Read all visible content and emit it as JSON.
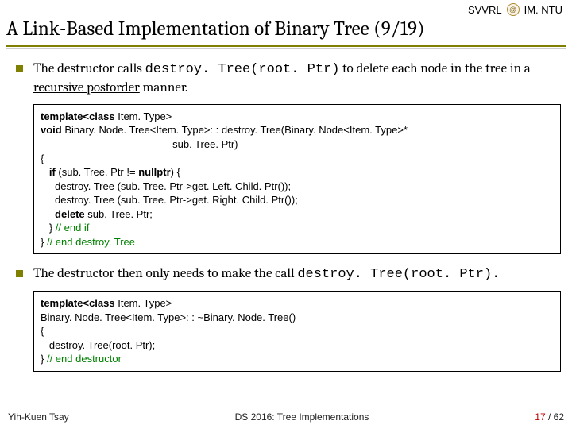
{
  "header": {
    "lab": "SVVRL",
    "at": "@",
    "org": "IM. NTU",
    "title": "A Link-Based Implementation of Binary Tree (9/19)"
  },
  "bullets": {
    "b1_pre": "The destructor calls ",
    "b1_code": "destroy. Tree(root. Ptr)",
    "b1_mid": " to delete each node in the tree in a ",
    "b1_u": "recursive postorder",
    "b1_post": " manner.",
    "b2_pre": "The destructor then only needs to make the call ",
    "b2_code": "destroy. Tree(root. Ptr)."
  },
  "code1": {
    "l1a": "template<",
    "l1b": "class",
    "l1c": " Item. Type>",
    "l2a": "void",
    "l2b": " Binary. Node. Tree<Item. Type>: : destroy. Tree(Binary. Node<Item. Type>*",
    "l3": "                                              sub. Tree. Ptr)",
    "l4": "{",
    "l5a": "   if",
    "l5b": " (sub. Tree. Ptr != ",
    "l5c": "nullptr",
    "l5d": ") {",
    "l6": "     destroy. Tree (sub. Tree. Ptr->get. Left. Child. Ptr());",
    "l7": "     destroy. Tree (sub. Tree. Ptr->get. Right. Child. Ptr());",
    "l8a": "     delete",
    "l8b": " sub. Tree. Ptr;",
    "l9a": "   } ",
    "l9b": "// end if",
    "l10a": "} ",
    "l10b": "// end destroy. Tree"
  },
  "code2": {
    "l1a": "template<",
    "l1b": "class",
    "l1c": " Item. Type>",
    "l2": "Binary. Node. Tree<Item. Type>: : ~Binary. Node. Tree()",
    "l3": "{",
    "l4": "   destroy. Tree(root. Ptr);",
    "l5a": "} ",
    "l5b": "// end destructor"
  },
  "footer": {
    "author": "Yih-Kuen Tsay",
    "course": "DS 2016: Tree Implementations",
    "page_current": "17",
    "page_sep": " / ",
    "page_total": "62"
  }
}
